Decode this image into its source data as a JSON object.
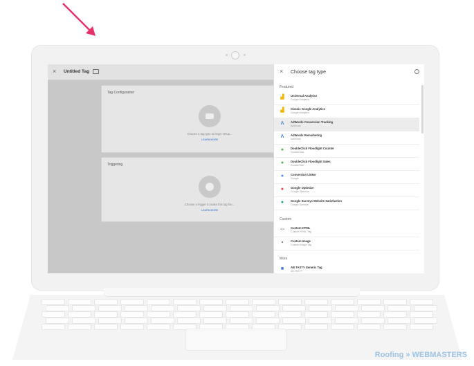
{
  "editor": {
    "title": "Untitled Tag",
    "tag_configuration": {
      "heading": "Tag Configuration",
      "hint": "Choose a tag type to begin setup...",
      "learn_more": "LEARN MORE"
    },
    "triggering": {
      "heading": "Triggering",
      "hint": "Choose a trigger to make this tag fire...",
      "learn_more": "LEARN MORE"
    }
  },
  "panel": {
    "title": "Choose tag type",
    "sections": [
      {
        "label": "Featured",
        "items": [
          {
            "title": "Universal Analytics",
            "subtitle": "Google Analytics",
            "icon": "analytics-icon",
            "color": "#f4b400"
          },
          {
            "title": "Classic Google Analytics",
            "subtitle": "Google Analytics",
            "icon": "analytics-icon",
            "color": "#f4b400"
          },
          {
            "title": "AdWords Conversion Tracking",
            "subtitle": "AdWords",
            "icon": "adwords-icon",
            "color": "#3f7fd6",
            "highlighted": true
          },
          {
            "title": "AdWords Remarketing",
            "subtitle": "AdWords",
            "icon": "adwords-icon",
            "color": "#3f7fd6"
          },
          {
            "title": "DoubleClick Floodlight Counter",
            "subtitle": "DoubleClick",
            "icon": "doubleclick-icon",
            "color": "#4caf50"
          },
          {
            "title": "DoubleClick Floodlight Sales",
            "subtitle": "DoubleClick",
            "icon": "doubleclick-icon",
            "color": "#4caf50"
          },
          {
            "title": "Conversion Linker",
            "subtitle": "Google",
            "icon": "linker-icon",
            "color": "#4a8cf0"
          },
          {
            "title": "Google Optimize",
            "subtitle": "Google Optimize",
            "icon": "optimize-icon",
            "color": "#e0434c"
          },
          {
            "title": "Google Surveys Website Satisfaction",
            "subtitle": "Google Surveys",
            "icon": "surveys-icon",
            "color": "#20a57a"
          }
        ]
      },
      {
        "label": "Custom",
        "items": [
          {
            "title": "Custom HTML",
            "subtitle": "Custom HTML Tag",
            "icon": "code-icon",
            "color": "#666666"
          },
          {
            "title": "Custom Image",
            "subtitle": "Custom Image Tag",
            "icon": "image-icon",
            "color": "#555555"
          }
        ]
      },
      {
        "label": "More",
        "items": [
          {
            "title": "AB TASTY Generic Tag",
            "subtitle": "AB TASTY",
            "icon": "abtasty-icon",
            "color": "#3b6fd6"
          }
        ]
      }
    ]
  },
  "watermark": {
    "text": "Roofing » WEBMASTERS"
  }
}
